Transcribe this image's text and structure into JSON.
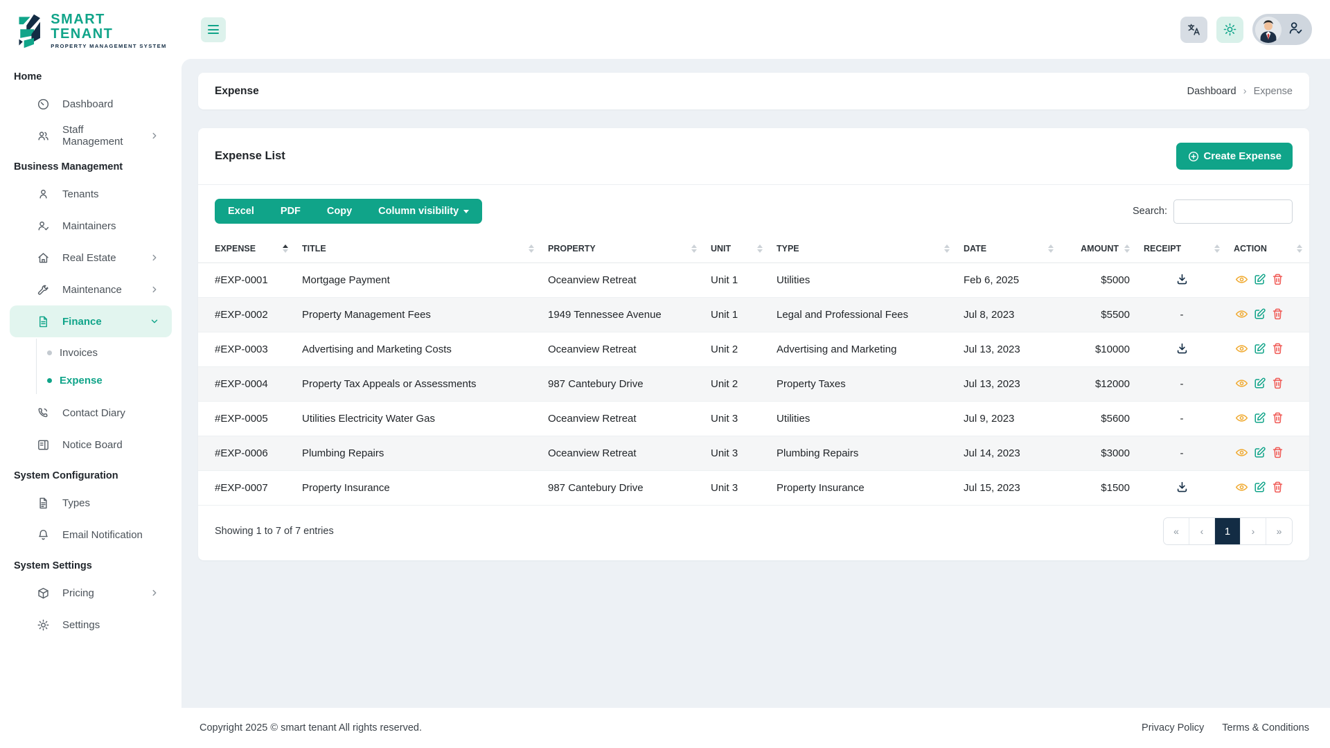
{
  "brand": {
    "name": "SMART TENANT",
    "tagline": "PROPERTY MANAGEMENT SYSTEM"
  },
  "sidebar": {
    "sections": [
      {
        "label": "Home",
        "items": [
          {
            "label": "Dashboard",
            "icon": "dashboard"
          },
          {
            "label": "Staff Management",
            "icon": "users",
            "chevron": true
          }
        ]
      },
      {
        "label": "Business Management",
        "items": [
          {
            "label": "Tenants",
            "icon": "user"
          },
          {
            "label": "Maintainers",
            "icon": "user-check"
          },
          {
            "label": "Real Estate",
            "icon": "home",
            "chevron": true
          },
          {
            "label": "Maintenance",
            "icon": "wrench",
            "chevron": true
          },
          {
            "label": "Finance",
            "icon": "file-invoice",
            "chevron": true,
            "expanded": true,
            "active": true,
            "children": [
              {
                "label": "Invoices"
              },
              {
                "label": "Expense",
                "active": true
              }
            ]
          },
          {
            "label": "Contact Diary",
            "icon": "phone"
          },
          {
            "label": "Notice Board",
            "icon": "board"
          }
        ]
      },
      {
        "label": "System Configuration",
        "items": [
          {
            "label": "Types",
            "icon": "file-text"
          },
          {
            "label": "Email Notification",
            "icon": "bell"
          }
        ]
      },
      {
        "label": "System Settings",
        "items": [
          {
            "label": "Pricing",
            "icon": "box",
            "chevron": true
          },
          {
            "label": "Settings",
            "icon": "gear"
          }
        ]
      }
    ]
  },
  "page": {
    "title": "Expense",
    "breadcrumb": {
      "parent": "Dashboard",
      "separator": "›",
      "current": "Expense"
    }
  },
  "panel": {
    "title": "Expense List",
    "create_label": "Create Expense",
    "export_buttons": [
      "Excel",
      "PDF",
      "Copy"
    ],
    "column_visibility_label": "Column visibility",
    "search_label": "Search:",
    "search_value": ""
  },
  "table": {
    "columns": [
      {
        "label": "EXPENSE",
        "sorted": "asc"
      },
      {
        "label": "TITLE"
      },
      {
        "label": "PROPERTY"
      },
      {
        "label": "UNIT"
      },
      {
        "label": "TYPE"
      },
      {
        "label": "DATE"
      },
      {
        "label": "AMOUNT",
        "align": "right"
      },
      {
        "label": "RECEIPT"
      },
      {
        "label": "ACTION"
      }
    ],
    "rows": [
      {
        "expense": "#EXP-0001",
        "title": "Mortgage Payment",
        "property": "Oceanview Retreat",
        "unit": "Unit 1",
        "type": "Utilities",
        "date": "Feb 6, 2025",
        "amount": "$5000",
        "receipt": true
      },
      {
        "expense": "#EXP-0002",
        "title": "Property Management Fees",
        "property": "1949 Tennessee Avenue",
        "unit": "Unit 1",
        "type": "Legal and Professional Fees",
        "date": "Jul 8, 2023",
        "amount": "$5500",
        "receipt": false
      },
      {
        "expense": "#EXP-0003",
        "title": "Advertising and Marketing Costs",
        "property": "Oceanview Retreat",
        "unit": "Unit 2",
        "type": "Advertising and Marketing",
        "date": "Jul 13, 2023",
        "amount": "$10000",
        "receipt": true
      },
      {
        "expense": "#EXP-0004",
        "title": "Property Tax Appeals or Assessments",
        "property": "987 Cantebury Drive",
        "unit": "Unit 2",
        "type": "Property Taxes",
        "date": "Jul 13, 2023",
        "amount": "$12000",
        "receipt": false
      },
      {
        "expense": "#EXP-0005",
        "title": "Utilities Electricity Water Gas",
        "property": "Oceanview Retreat",
        "unit": "Unit 3",
        "type": "Utilities",
        "date": "Jul 9, 2023",
        "amount": "$5600",
        "receipt": false
      },
      {
        "expense": "#EXP-0006",
        "title": "Plumbing Repairs",
        "property": "Oceanview Retreat",
        "unit": "Unit 3",
        "type": "Plumbing Repairs",
        "date": "Jul 14, 2023",
        "amount": "$3000",
        "receipt": false
      },
      {
        "expense": "#EXP-0007",
        "title": "Property Insurance",
        "property": "987 Cantebury Drive",
        "unit": "Unit 3",
        "type": "Property Insurance",
        "date": "Jul 15, 2023",
        "amount": "$1500",
        "receipt": true
      }
    ],
    "empty_receipt": "-",
    "summary": "Showing 1 to 7 of 7 entries",
    "pagination": {
      "first": "«",
      "previous": "‹",
      "current": "1",
      "next": "›",
      "last": "»"
    }
  },
  "footer": {
    "copyright": "Copyright 2025 © smart tenant All rights reserved.",
    "links": [
      "Privacy Policy",
      "Terms & Conditions"
    ]
  },
  "colors": {
    "primary": "#10a489",
    "navy": "#132c44",
    "view": "#f0a92e",
    "edit": "#10a489",
    "delete": "#f05a55"
  }
}
